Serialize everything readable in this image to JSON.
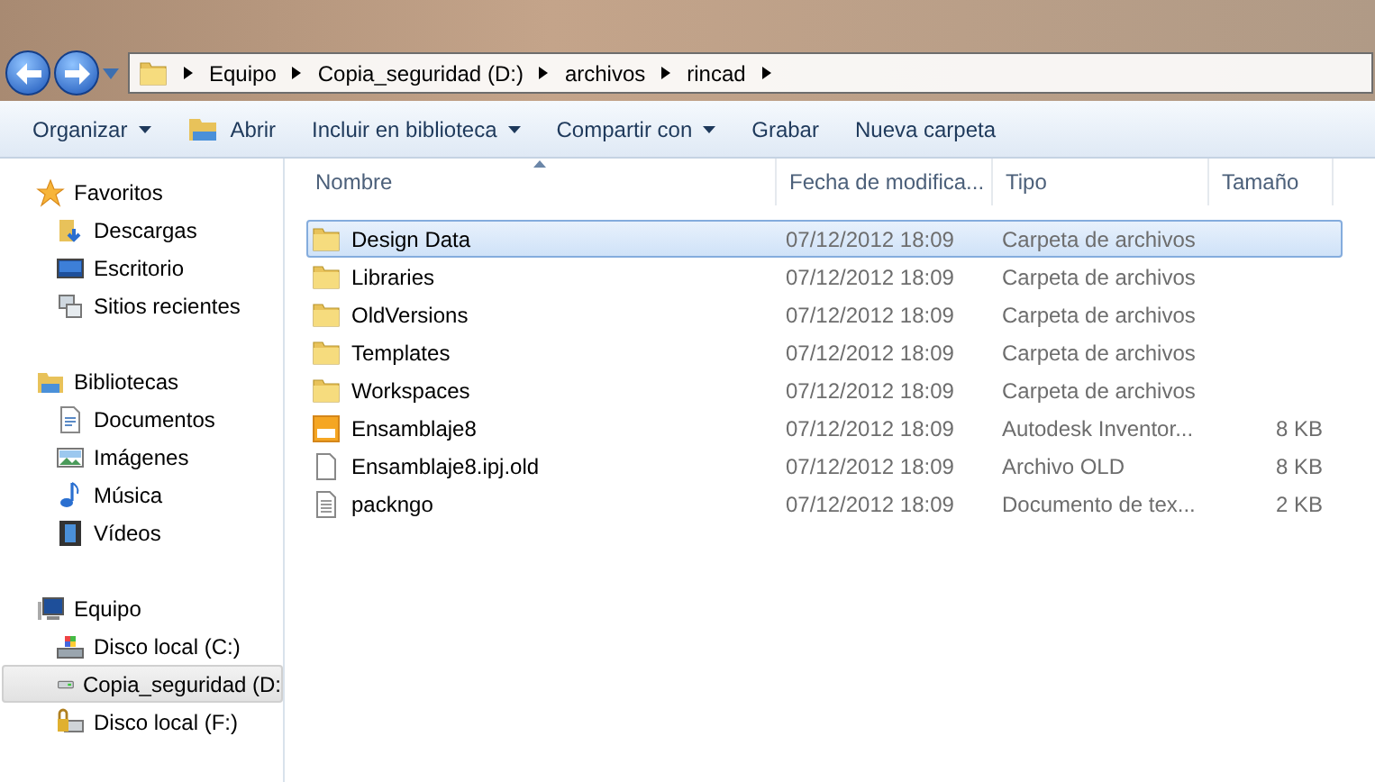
{
  "address_bar": {
    "segments": [
      "Equipo",
      "Copia_seguridad (D:)",
      "archivos",
      "rincad"
    ]
  },
  "toolbar": [
    {
      "label": "Organizar",
      "kind": "menu"
    },
    {
      "label": "Abrir",
      "kind": "open"
    },
    {
      "label": "Incluir en biblioteca",
      "kind": "menu"
    },
    {
      "label": "Compartir con",
      "kind": "menu"
    },
    {
      "label": "Grabar",
      "kind": "plain"
    },
    {
      "label": "Nueva carpeta",
      "kind": "plain"
    }
  ],
  "sidebar": {
    "groups": [
      {
        "label": "Favoritos",
        "kind": "star",
        "children": [
          {
            "label": "Descargas",
            "kind": "downloads",
            "selected": false
          },
          {
            "label": "Escritorio",
            "kind": "desktop",
            "selected": false
          },
          {
            "label": "Sitios recientes",
            "kind": "recent",
            "selected": false
          }
        ]
      },
      {
        "label": "Bibliotecas",
        "kind": "library",
        "children": [
          {
            "label": "Documentos",
            "kind": "document",
            "selected": false
          },
          {
            "label": "Imágenes",
            "kind": "image",
            "selected": false
          },
          {
            "label": "Música",
            "kind": "music",
            "selected": false
          },
          {
            "label": "Vídeos",
            "kind": "video",
            "selected": false
          }
        ]
      },
      {
        "label": "Equipo",
        "kind": "computer",
        "children": [
          {
            "label": "Disco local (C:)",
            "kind": "windrive",
            "selected": false
          },
          {
            "label": "Copia_seguridad (D:",
            "kind": "drive",
            "selected": true
          },
          {
            "label": "Disco local (F:)",
            "kind": "lockdrive",
            "selected": false
          }
        ]
      }
    ]
  },
  "table": {
    "columns": [
      "Nombre",
      "Fecha de modifica...",
      "Tipo",
      "Tamaño"
    ],
    "rows": [
      {
        "name": "Design Data",
        "date": "07/12/2012 18:09",
        "type": "Carpeta de archivos",
        "kind": "folder",
        "selected": true
      },
      {
        "name": "Libraries",
        "date": "07/12/2012 18:09",
        "type": "Carpeta de archivos",
        "kind": "folder",
        "selected": false
      },
      {
        "name": "OldVersions",
        "date": "07/12/2012 18:09",
        "type": "Carpeta de archivos",
        "kind": "folder",
        "selected": false
      },
      {
        "name": "Templates",
        "date": "07/12/2012 18:09",
        "type": "Carpeta de archivos",
        "kind": "folder",
        "selected": false
      },
      {
        "name": "Workspaces",
        "date": "07/12/2012 18:09",
        "type": "Carpeta de archivos",
        "kind": "folder",
        "selected": false
      },
      {
        "name": "Ensamblaje8",
        "date": "07/12/2012 18:09",
        "type": "Autodesk Inventor...",
        "size": "8 KB",
        "kind": "project",
        "selected": false
      },
      {
        "name": "Ensamblaje8.ipj.old",
        "date": "07/12/2012 18:09",
        "type": "Archivo OLD",
        "size": "8 KB",
        "kind": "file",
        "selected": false
      },
      {
        "name": "packngo",
        "date": "07/12/2012 18:09",
        "type": "Documento de tex...",
        "size": "2 KB",
        "kind": "text",
        "selected": false
      }
    ]
  }
}
